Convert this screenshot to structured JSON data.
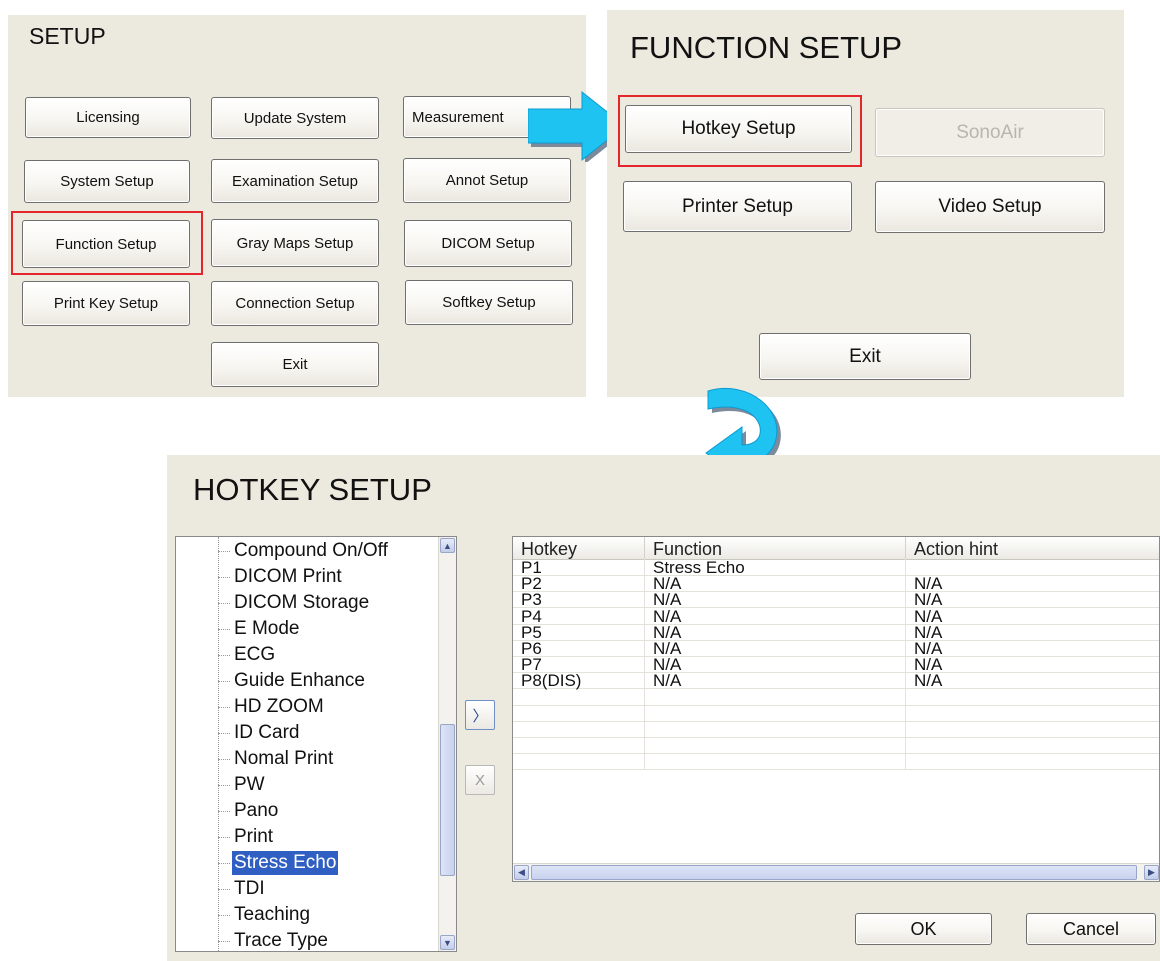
{
  "setup": {
    "title": "SETUP",
    "buttons": {
      "licensing": "Licensing",
      "update_system": "Update System",
      "measurement": "Measurement",
      "system_setup": "System Setup",
      "examination_setup": "Examination Setup",
      "annot_setup": "Annot Setup",
      "function_setup": "Function Setup",
      "gray_maps_setup": "Gray Maps Setup",
      "dicom_setup": "DICOM Setup",
      "print_key_setup": "Print Key Setup",
      "connection_setup": "Connection Setup",
      "softkey_setup": "Softkey Setup",
      "exit": "Exit"
    }
  },
  "function_setup": {
    "title": "FUNCTION SETUP",
    "buttons": {
      "hotkey_setup": "Hotkey Setup",
      "sonoair": "SonoAir",
      "printer_setup": "Printer Setup",
      "video_setup": "Video Setup",
      "exit": "Exit"
    }
  },
  "hotkey_setup": {
    "title": "HOTKEY SETUP",
    "tree_items": [
      "Compound On/Off",
      "DICOM Print",
      "DICOM Storage",
      "E Mode",
      "ECG",
      "Guide Enhance",
      "HD ZOOM",
      "ID Card",
      "Nomal Print",
      "PW",
      "Pano",
      "Print",
      "Stress Echo",
      "TDI",
      "Teaching",
      "Trace Type"
    ],
    "selected_item": "Stress Echo",
    "add_button": "〉",
    "remove_button": "X",
    "columns": [
      "Hotkey",
      "Function",
      "Action hint"
    ],
    "rows": [
      [
        "P1",
        "Stress Echo",
        ""
      ],
      [
        "P2",
        "N/A",
        "N/A"
      ],
      [
        "P3",
        "N/A",
        "N/A"
      ],
      [
        "P4",
        "N/A",
        "N/A"
      ],
      [
        "P5",
        "N/A",
        "N/A"
      ],
      [
        "P6",
        "N/A",
        "N/A"
      ],
      [
        "P7",
        "N/A",
        "N/A"
      ],
      [
        "P8(DIS)",
        "N/A",
        "N/A"
      ]
    ],
    "ok": "OK",
    "cancel": "Cancel"
  },
  "colors": {
    "panel_bg": "#ece9de",
    "highlight_red": "#e3262b",
    "arrow_cyan": "#1fc3f2",
    "selection_blue": "#2f5fc2"
  }
}
